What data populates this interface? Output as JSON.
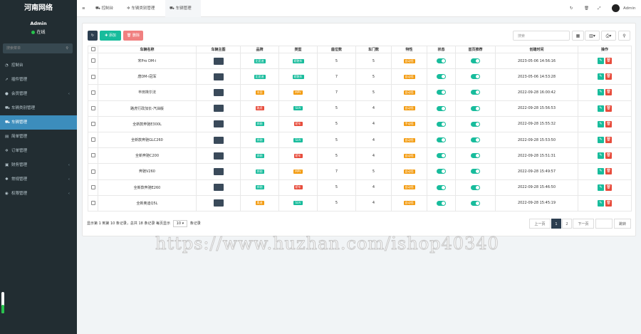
{
  "app": {
    "title": "河南网络"
  },
  "user": {
    "name": "Admin",
    "status": "在线"
  },
  "sidebar": {
    "search_placeholder": "搜索菜单",
    "items": [
      {
        "label": "控制台",
        "icon": "dashboard-icon",
        "glyph": "◔",
        "arrow": false
      },
      {
        "label": "插件管理",
        "icon": "rocket-icon",
        "glyph": "➚",
        "arrow": false
      },
      {
        "label": "会员管理",
        "icon": "user-icon",
        "glyph": "●",
        "arrow": true
      },
      {
        "label": "车辆类别管理",
        "icon": "car-icon",
        "glyph": "⛟",
        "arrow": false
      },
      {
        "label": "车辆管理",
        "icon": "car-icon",
        "glyph": "⛟",
        "arrow": false,
        "active": true
      },
      {
        "label": "简单管理",
        "icon": "list-icon",
        "glyph": "▤",
        "arrow": false
      },
      {
        "label": "订单管理",
        "icon": "gear-icon",
        "glyph": "✲",
        "arrow": false
      },
      {
        "label": "财务管理",
        "icon": "lock-icon",
        "glyph": "▣",
        "arrow": true
      },
      {
        "label": "常规管理",
        "icon": "cogs-icon",
        "glyph": "✱",
        "arrow": true
      },
      {
        "label": "权限管理",
        "icon": "group-icon",
        "glyph": "◉",
        "arrow": true
      }
    ],
    "progress": 0.4
  },
  "topbar": {
    "tabs": [
      "控制台",
      "车辆类别管理",
      "车辆管理"
    ],
    "user": "Admin"
  },
  "toolbar": {
    "add": "添加",
    "delete": "删除",
    "search_placeholder": "搜索"
  },
  "table": {
    "headers": [
      "车辆名称",
      "车辆主图",
      "品牌",
      "类型",
      "座位数",
      "车门数",
      "特性",
      "状态",
      "首页推荐",
      "创建时间",
      "操作"
    ],
    "rows": [
      {
        "name": "宋Pro DM-i",
        "brand": "比亚迪",
        "brand_color": "#18bc9c",
        "type": "轿跑车",
        "type_color": "#18bc9c",
        "seats": "5",
        "doors": "5",
        "feature": "自动挡",
        "created": "2023-05-06 14:56:16"
      },
      {
        "name": "唐DM-i冠军",
        "brand": "比亚迪",
        "brand_color": "#18bc9c",
        "type": "轿跑车",
        "type_color": "#18bc9c",
        "seats": "7",
        "doors": "5",
        "feature": "自动挡",
        "created": "2023-05-06 14:53:28"
      },
      {
        "name": "丰田埃尔法",
        "brand": "丰田",
        "brand_color": "#f39c12",
        "type": "MPV",
        "type_color": "#f39c12",
        "seats": "7",
        "doors": "5",
        "feature": "自动挡",
        "created": "2022-09-28 16:00:42"
      },
      {
        "name": "路虎行政加长-汽油版",
        "brand": "路虎",
        "brand_color": "#e74c3c",
        "type": "SUV",
        "type_color": "#18bc9c",
        "seats": "5",
        "doors": "4",
        "feature": "自动挡",
        "created": "2022-09-28 15:56:53"
      },
      {
        "name": "全新款奔驰E300L",
        "brand": "奔驰",
        "brand_color": "#18bc9c",
        "type": "轿车",
        "type_color": "#e74c3c",
        "seats": "5",
        "doors": "4",
        "feature": "手动挡",
        "created": "2022-09-28 15:55:32"
      },
      {
        "name": "全新款奔驰GLC260",
        "brand": "奔驰",
        "brand_color": "#18bc9c",
        "type": "SUV",
        "type_color": "#18bc9c",
        "seats": "5",
        "doors": "4",
        "feature": "自动挡",
        "created": "2022-09-28 15:53:50"
      },
      {
        "name": "全新奔驰C200",
        "brand": "奔驰",
        "brand_color": "#18bc9c",
        "type": "轿车",
        "type_color": "#e74c3c",
        "seats": "5",
        "doors": "4",
        "feature": "自动挡",
        "created": "2022-09-28 15:51:31"
      },
      {
        "name": "奔驰V260",
        "brand": "奔驰",
        "brand_color": "#18bc9c",
        "type": "MPV",
        "type_color": "#f39c12",
        "seats": "7",
        "doors": "5",
        "feature": "自动挡",
        "created": "2022-09-28 15:49:57"
      },
      {
        "name": "全新款奔驰E260",
        "brand": "奔驰",
        "brand_color": "#18bc9c",
        "type": "轿车",
        "type_color": "#e74c3c",
        "seats": "5",
        "doors": "4",
        "feature": "自动挡",
        "created": "2022-09-28 15:46:50"
      },
      {
        "name": "全新奥迪Q5L",
        "brand": "奥迪",
        "brand_color": "#f39c12",
        "type": "SUV",
        "type_color": "#18bc9c",
        "seats": "5",
        "doors": "4",
        "feature": "自动挡",
        "created": "2022-09-28 15:45:19"
      }
    ]
  },
  "footer": {
    "info": "显示第 1 到第 10 条记录，总共 18 条记录 每页显示",
    "page_size": "10",
    "suffix": "条记录"
  },
  "pagination": {
    "prev": "上一页",
    "pages": [
      "1",
      "2"
    ],
    "next": "下一页",
    "jump": "跳转"
  },
  "watermark": "https://www.huzhan.com/ishop40340"
}
